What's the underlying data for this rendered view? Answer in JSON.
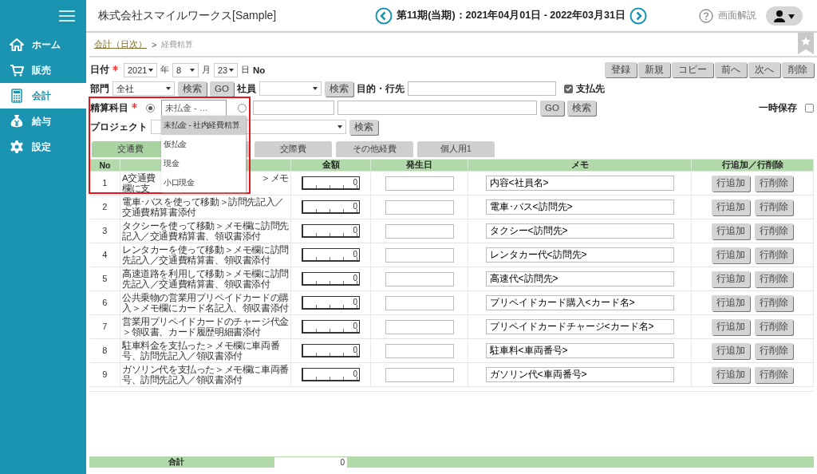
{
  "sidebar": {
    "items": [
      {
        "label": "ホーム",
        "selected": false
      },
      {
        "label": "販売",
        "selected": false
      },
      {
        "label": "会計",
        "selected": true
      },
      {
        "label": "給与",
        "selected": false
      },
      {
        "label": "設定",
        "selected": false
      }
    ]
  },
  "header": {
    "company": "株式会社スマイルワークス[Sample]",
    "period": "第11期(当期)：2021年04月01日 - 2022年03月31日",
    "help": "画面解説"
  },
  "breadcrumb": {
    "link": "会計（日次）",
    "separator": ">",
    "current": "経費精算"
  },
  "actions": [
    "登録",
    "新規",
    "コピー",
    "前へ",
    "次へ",
    "削除"
  ],
  "date_row": {
    "label": "日付",
    "required": true,
    "year": "2021",
    "year_unit": "年",
    "month": "8",
    "month_unit": "月",
    "day": "23",
    "day_unit": "日",
    "no_label": "No"
  },
  "dept_row": {
    "dept_label": "部門",
    "dept": "全社",
    "search": "検索",
    "go": "GO",
    "employee_label": "社員",
    "employee_search": "検索",
    "purpose_label": "目的・行先",
    "payee_checked": true,
    "payee_label": "支払先"
  },
  "account_row": {
    "label": "精算科目",
    "required": true,
    "select_value": "未払金 - …",
    "select_chosen": true,
    "free_chosen": false,
    "go": "GO",
    "search": "検索",
    "temp_save_label": "一時保存",
    "temp_save_checked": false
  },
  "project_row": {
    "label": "プロジェクト",
    "search": "検索"
  },
  "dropdown": {
    "options": [
      {
        "label": "未払金 - 社内経費精算",
        "selected": true
      },
      {
        "label": "仮払金",
        "selected": false
      },
      {
        "label": "現金",
        "selected": false
      },
      {
        "label": "小口現金",
        "selected": false
      }
    ]
  },
  "tabs": [
    {
      "label": "交通費",
      "selected": true
    },
    {
      "selected": false
    },
    {
      "label": "交際費",
      "selected": false
    },
    {
      "label": "その他経費",
      "selected": false
    },
    {
      "label": "個人用1",
      "selected": false
    }
  ],
  "table": {
    "columns": {
      "no": "No",
      "amount": "金額",
      "date": "発生日",
      "memo": "メモ",
      "actions": "行追加／行削除"
    },
    "rows": [
      {
        "no": "1",
        "fragments": [
          [
            "A交通費",
            "＞メモ"
          ],
          [
            "欄に支"
          ]
        ],
        "amount": "0",
        "memo": "内容<社員名>",
        "add": "行追加",
        "remove": "行削除"
      },
      {
        "no": "2",
        "description": "電車･バスを使って移動＞訪問先記入／交通費精算書添付",
        "amount": "0",
        "memo": "電車･バス<訪問先>",
        "add": "行追加",
        "remove": "行削除"
      },
      {
        "no": "3",
        "description": "タクシーを使って移動＞メモ欄に訪問先記入／交通費精算書、領収書添付",
        "amount": "0",
        "memo": "タクシー<訪問先>",
        "add": "行追加",
        "remove": "行削除"
      },
      {
        "no": "4",
        "description": "レンタカーを使って移動＞メモ欄に訪問先記入／交通費精算書、領収書添付",
        "amount": "0",
        "memo": "レンタカー代<訪問先>",
        "add": "行追加",
        "remove": "行削除"
      },
      {
        "no": "5",
        "description": "高速道路を利用して移動＞メモ欄に訪問先記入／交通費精算書、領収書添付",
        "amount": "0",
        "memo": "高速代<訪問先>",
        "add": "行追加",
        "remove": "行削除"
      },
      {
        "no": "6",
        "description": "公共乗物の営業用プリペイドカードの購入＞メモ欄にカード名記入、領収書添付",
        "amount": "0",
        "memo": "プリペイドカード購入<カード名>",
        "add": "行追加",
        "remove": "行削除"
      },
      {
        "no": "7",
        "description": "営業用プリペイドカードのチャージ代金＞領収書、カード履歴明細書添付",
        "amount": "0",
        "memo": "プリペイドカードチャージ<カード名>",
        "add": "行追加",
        "remove": "行削除"
      },
      {
        "no": "8",
        "description": "駐車料金を支払った＞メモ欄に車両番号、訪問先記入／領収書添付",
        "amount": "0",
        "memo": "駐車料<車両番号>",
        "add": "行追加",
        "remove": "行削除"
      },
      {
        "no": "9",
        "description": "ガソリン代を支払った＞メモ欄に車両番号、訪問先記入／領収書添付",
        "amount": "0",
        "memo": "ガソリン代<車両番号>",
        "add": "行追加",
        "remove": "行削除"
      }
    ]
  },
  "total": {
    "label": "合計",
    "value": "0"
  },
  "highlight_frame": true
}
